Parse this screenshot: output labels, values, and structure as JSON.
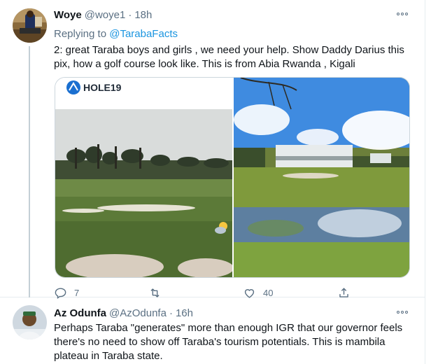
{
  "tweets": [
    {
      "name": "Woye",
      "handle": "@woye1",
      "dot": "·",
      "time": "18h",
      "replying_prefix": "Replying to ",
      "replying_to": "@TarabaFacts",
      "text": "2: great Taraba boys and girls , we need your help. Show Daddy Darius this pix, how a golf course look like.  This is from Abia Rwanda , Kigali",
      "media_left_watermark": "HOLE19",
      "actions": {
        "reply_count": "7",
        "retweet_count": "",
        "like_count": "40",
        "share_icon": "share-icon"
      }
    },
    {
      "name": "Az Odunfa",
      "handle": "@AzOdunfa",
      "dot": "·",
      "time": "16h",
      "text": "Perhaps Taraba \"generates\" more than enough IGR that our governor feels there's no need to show off Taraba's tourism potentials. This is mambila plateau in Taraba state."
    }
  ],
  "colors": {
    "accent": "#1b95e0",
    "secondary_text": "#5b7083",
    "primary_text": "#0f1419",
    "border": "#e6ecf0"
  },
  "icons": [
    "more-icon",
    "reply-icon",
    "retweet-icon",
    "like-icon",
    "share-icon",
    "hole19-logo-icon"
  ]
}
